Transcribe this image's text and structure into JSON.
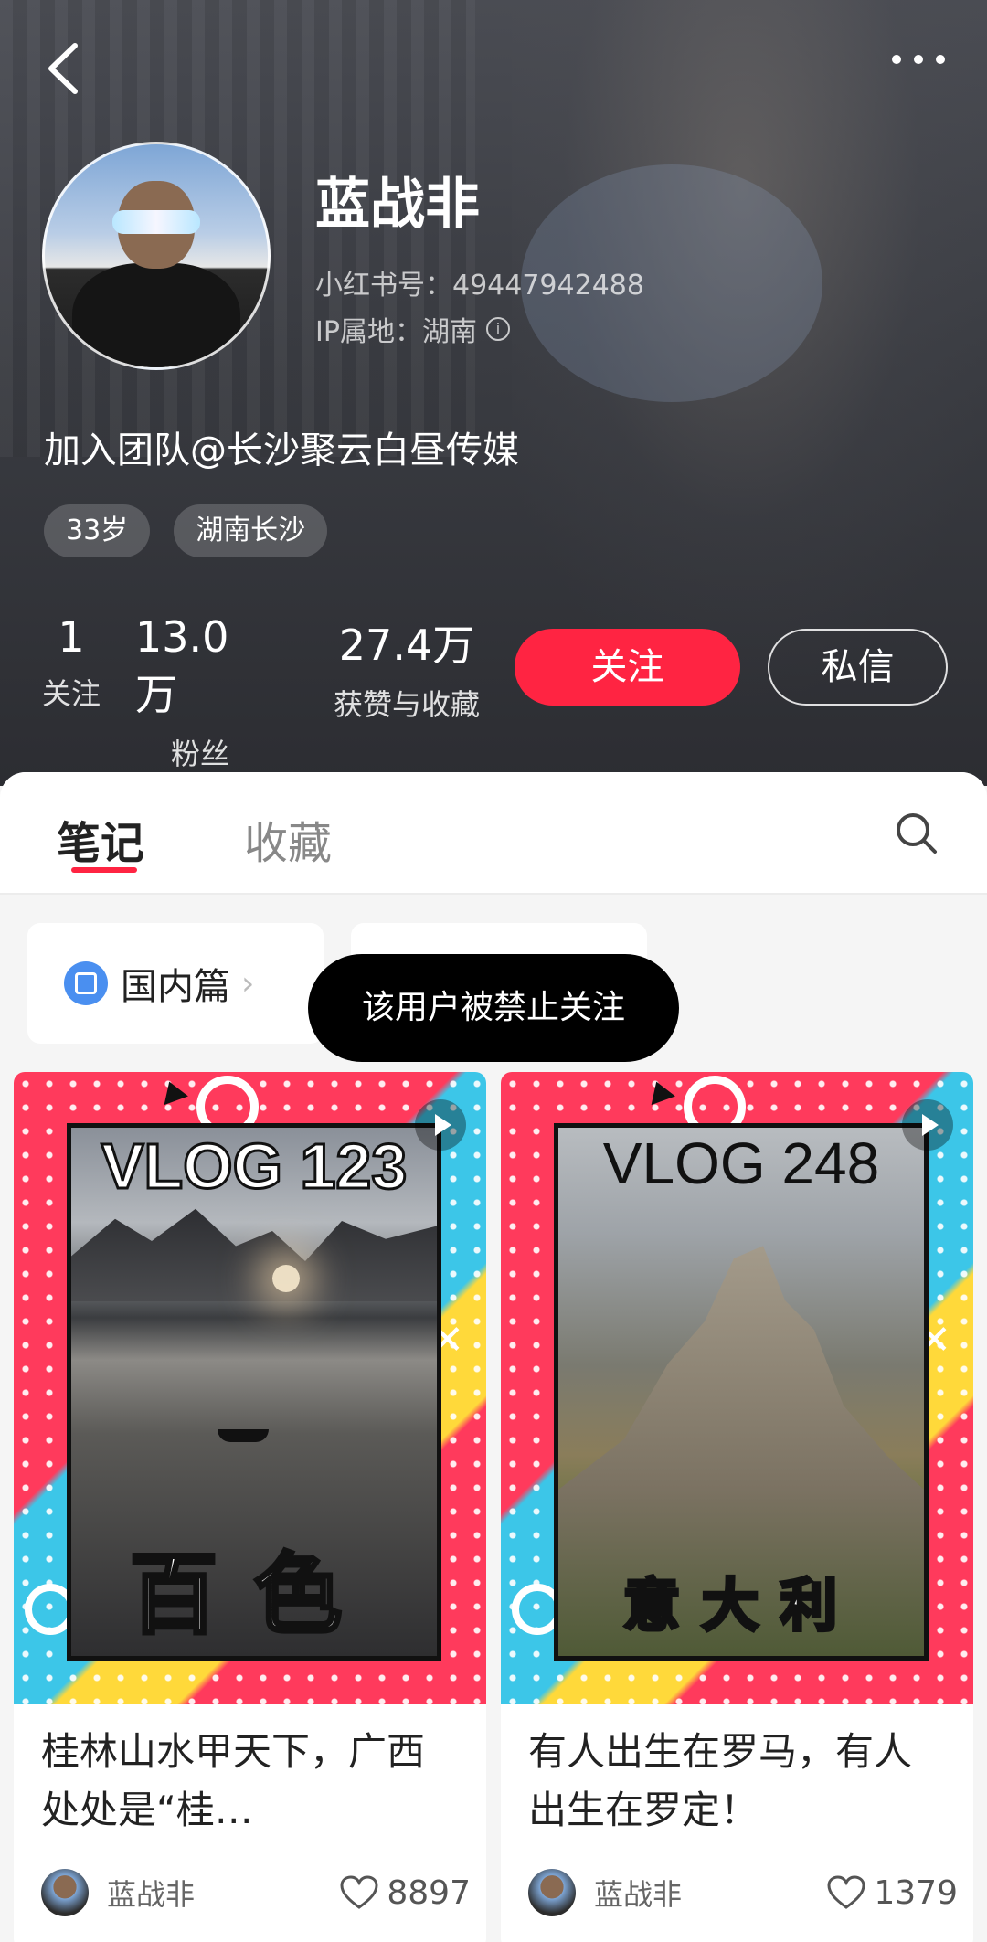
{
  "profile": {
    "name": "蓝战非",
    "red_id": "小红书号：49447942488",
    "ip": "IP属地：湖南",
    "bio": "加入团队@长沙聚云白昼传媒",
    "tags": [
      "33岁",
      "湖南长沙"
    ],
    "stats": [
      {
        "num": "1",
        "label": "关注"
      },
      {
        "num": "13.0万",
        "label": "粉丝"
      },
      {
        "num": "27.4万",
        "label": "获赞与收藏"
      }
    ],
    "follow_label": "关注",
    "message_label": "私信"
  },
  "tabs": {
    "notes": "笔记",
    "favorites": "收藏"
  },
  "collection": {
    "label": "国内篇"
  },
  "toast": "该用户被禁止关注",
  "notes": [
    {
      "cover_title": "VLOG 123",
      "cover_place": "百色",
      "title": "桂林山水甲天下，广西处处是“桂…",
      "author": "蓝战非",
      "likes": "8897"
    },
    {
      "cover_title": "VLOG 248",
      "cover_place": "意大利",
      "title": "有人出生在罗马，有人出生在罗定！",
      "author": "蓝战非",
      "likes": "1379"
    }
  ],
  "colors": {
    "accent": "#ff2442",
    "header_bg": "#3a3c42"
  }
}
